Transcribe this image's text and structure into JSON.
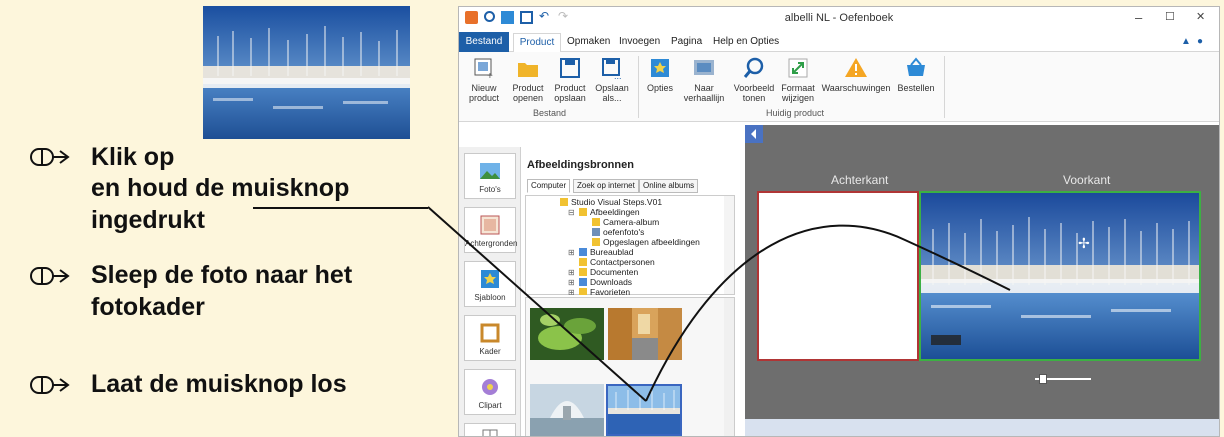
{
  "instructions": {
    "step1_line1": "Klik op",
    "step1_line2": "en houd de muisknop",
    "step1_line3": "ingedrukt",
    "step2_line1": "Sleep de foto naar het",
    "step2_line2": "fotokader",
    "step3_line1": "Laat de muisknop los"
  },
  "app": {
    "title": "albelli NL - Oefenboek",
    "window_controls": {
      "minimize": "–",
      "maximize": "☐",
      "close": "✕"
    },
    "menu": {
      "file": "Bestand",
      "active": "Product",
      "items": [
        "Opmaken",
        "Invoegen",
        "Pagina",
        "Help en Opties"
      ]
    },
    "ribbon": {
      "buttons": [
        {
          "label1": "Nieuw",
          "label2": "product",
          "icon": "new-product-icon"
        },
        {
          "label1": "Product",
          "label2": "openen",
          "icon": "folder-open-icon"
        },
        {
          "label1": "Product",
          "label2": "opslaan",
          "icon": "save-icon"
        },
        {
          "label1": "Opslaan",
          "label2": "als...",
          "icon": "save-as-icon"
        },
        {
          "label1": "Opties",
          "label2": "",
          "icon": "options-icon"
        },
        {
          "label1": "Naar",
          "label2": "verhaallijn",
          "icon": "storyline-icon"
        },
        {
          "label1": "Voorbeeld",
          "label2": "tonen",
          "icon": "preview-icon"
        },
        {
          "label1": "Formaat",
          "label2": "wijzigen",
          "icon": "resize-icon"
        },
        {
          "label1": "Waarschuwingen",
          "label2": "",
          "icon": "warning-icon"
        },
        {
          "label1": "Bestellen",
          "label2": "",
          "icon": "basket-icon"
        }
      ],
      "group1": "Bestand",
      "group2": "Huidig product"
    },
    "sidebar": [
      "Foto's",
      "Achtergronden",
      "Sjabloon",
      "Kader",
      "Clipart"
    ],
    "sources": {
      "title": "Afbeeldingsbronnen",
      "tabs": [
        "Computer",
        "Zoek op internet",
        "Online albums"
      ],
      "tree": [
        "Studio Visual Steps.V01",
        "Afbeeldingen",
        "Camera-album",
        "oefenfoto's",
        "Opgeslagen afbeeldingen",
        "Bureaublad",
        "Contactpersonen",
        "Documenten",
        "Downloads",
        "Favorieten"
      ]
    },
    "canvas": {
      "back_label": "Achterkant",
      "front_label": "Voorkant"
    }
  },
  "colors": {
    "background": "#fdf6dc",
    "accent_blue": "#1d5fa8",
    "back_border": "#b03535",
    "front_border": "#3cb043",
    "canvas": "#6e6e6e"
  }
}
